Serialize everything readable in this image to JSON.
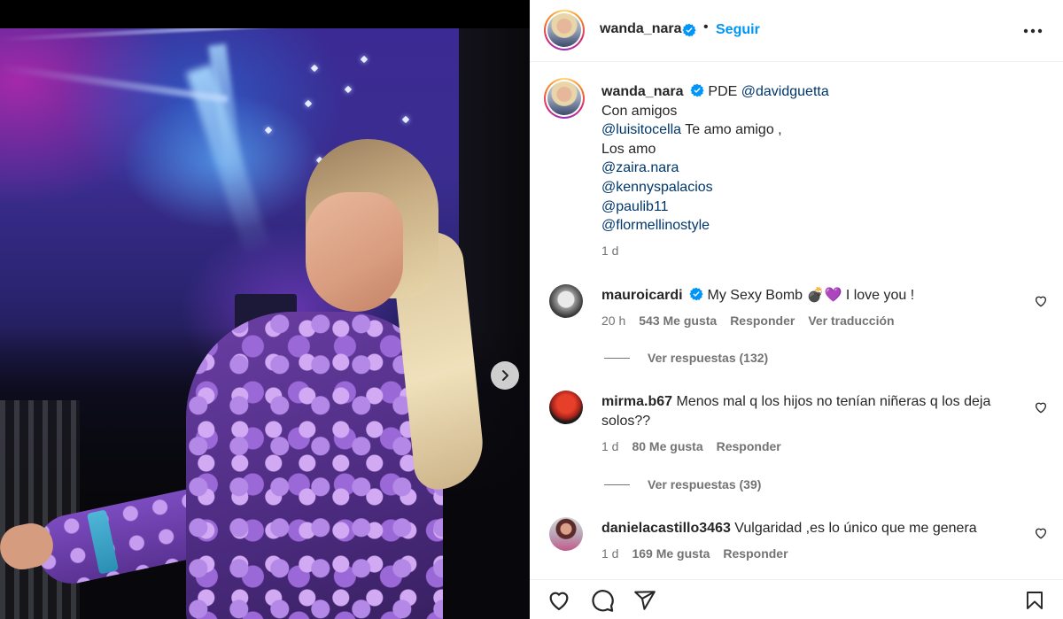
{
  "post": {
    "username": "wanda_nara",
    "follow_label": "Seguir",
    "dot_separator": "•",
    "caption": {
      "username": "wanda_nara",
      "first_line_text": "PDE",
      "first_line_mention": "@davidguetta",
      "line_2": "Con amigos",
      "line_3_mention": "@luisitocella",
      "line_3_text": " Te amo amigo ,",
      "line_4": "Los amo",
      "mentions": [
        "@zaira.nara",
        "@kennyspalacios",
        "@paulib11",
        "@flormellinostyle"
      ],
      "time": "1 d"
    },
    "comments": [
      {
        "username": "mauroicardi",
        "verified": true,
        "text_before": " My Sexy Bomb ",
        "emoji": "💣💜",
        "text_after": " I love you !",
        "time": "20 h",
        "likes": "543 Me gusta",
        "reply": "Responder",
        "translate": "Ver traducción",
        "view_replies": "Ver respuestas (132)"
      },
      {
        "username": "mirma.b67",
        "verified": false,
        "text": " Menos mal q los hijos no tenían niñeras q los deja solos??",
        "time": "1 d",
        "likes": "80 Me gusta",
        "reply": "Responder",
        "view_replies": "Ver respuestas (39)"
      },
      {
        "username": "danielacastillo3463",
        "verified": false,
        "text": " Vulgaridad ,es lo único que me genera",
        "time": "1 d",
        "likes": "169 Me gusta",
        "reply": "Responder"
      }
    ]
  },
  "icons": {
    "verified": "verified-badge-icon",
    "more": "more-options-icon",
    "next": "chevron-right-icon",
    "like": "heart-icon",
    "comment": "comment-icon",
    "share": "share-icon",
    "save": "bookmark-icon"
  },
  "colors": {
    "accent": "#0095f6",
    "mention": "#00376b",
    "secondary_text": "#737373",
    "primary_text": "#262626"
  }
}
